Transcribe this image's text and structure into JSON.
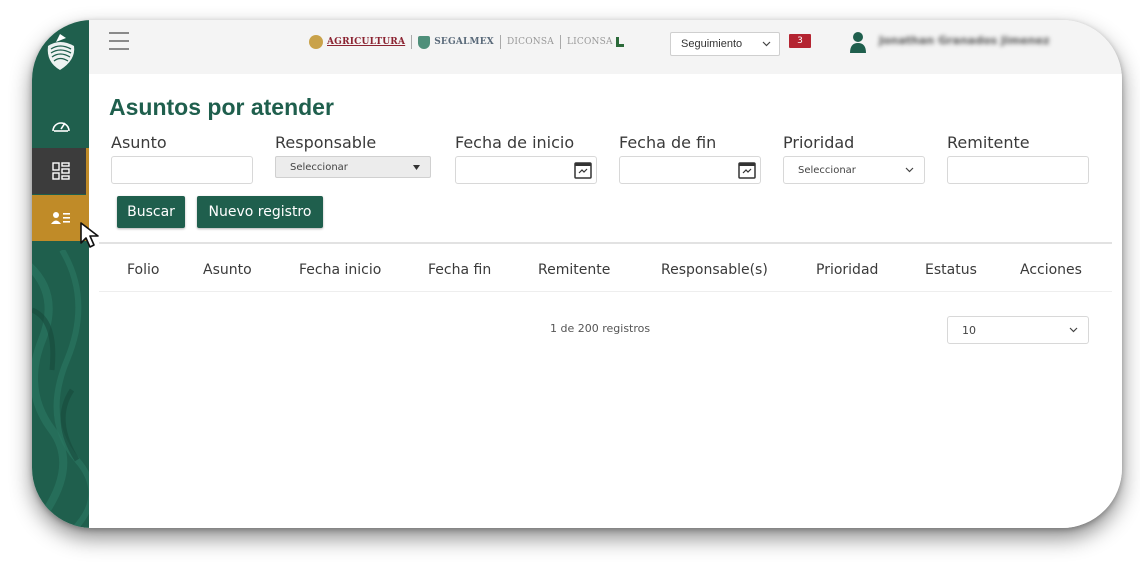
{
  "topbar": {
    "brands": [
      "AGRICULTURA",
      "SEGALMEX",
      "DICONSA",
      "LICONSA"
    ],
    "module_select": "Seguimiento",
    "notification_count": "3",
    "user_name": "Jonathan Granados Jimenez"
  },
  "sidebar": {
    "items": [
      {
        "icon": "dashboard-gauge-icon"
      },
      {
        "icon": "apps-grid-icon"
      },
      {
        "icon": "people-list-icon",
        "active": true
      }
    ]
  },
  "page": {
    "title": "Asuntos por atender"
  },
  "filters": {
    "asunto_label": "Asunto",
    "responsable_label": "Responsable",
    "responsable_value": "Seleccionar",
    "fecha_inicio_label": "Fecha de inicio",
    "fecha_fin_label": "Fecha de fin",
    "prioridad_label": "Prioridad",
    "prioridad_value": "Seleccionar",
    "remitente_label": "Remitente"
  },
  "actions": {
    "search_label": "Buscar",
    "new_label": "Nuevo registro"
  },
  "table": {
    "columns": [
      "Folio",
      "Asunto",
      "Fecha inicio",
      "Fecha fin",
      "Remitente",
      "Responsable(s)",
      "Prioridad",
      "Estatus",
      "Acciones"
    ],
    "rows": []
  },
  "pagination": {
    "summary": "1 de 200 registros",
    "page_size": "10"
  },
  "colors": {
    "primary": "#1f5f4d",
    "accent": "#c08b28",
    "danger": "#b42431"
  }
}
